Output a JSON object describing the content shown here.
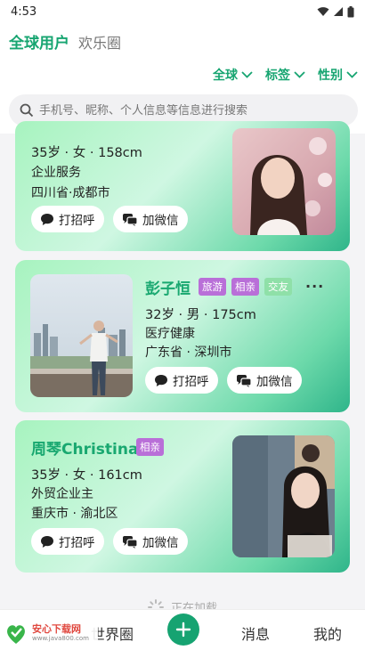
{
  "status": {
    "time": "4:53"
  },
  "header": {
    "tabs": [
      {
        "label": "全球用户",
        "active": true
      },
      {
        "label": "欢乐圈",
        "active": false
      }
    ],
    "filters": [
      {
        "label": "全球"
      },
      {
        "label": "标签"
      },
      {
        "label": "性别"
      }
    ],
    "search": {
      "placeholder": "手机号、昵称、个人信息等信息进行搜索"
    }
  },
  "cards": [
    {
      "name": "",
      "age_gender_height": "35岁 · 女 · 158cm",
      "industry": "企业服务",
      "location": "四川省·成都市",
      "greet_label": "打招呼",
      "wechat_label": "加微信"
    },
    {
      "name": "彭子恒",
      "tags": [
        "旅游",
        "相亲",
        "交友"
      ],
      "more": "···",
      "age_gender_height": "32岁 · 男 · 175cm",
      "industry": "医疗健康",
      "location": "广东省 · 深圳市",
      "greet_label": "打招呼",
      "wechat_label": "加微信"
    },
    {
      "name": "周琴Christina",
      "tags": [
        "相亲"
      ],
      "age_gender_height": "35岁 · 女 · 161cm",
      "industry": "外贸企业主",
      "location": "重庆市 · 渝北区",
      "greet_label": "打招呼",
      "wechat_label": "加微信"
    }
  ],
  "loading_text": "正在加载",
  "bottom_nav": {
    "world": "世界圈",
    "messages": "消息",
    "mine": "我的"
  },
  "watermark": {
    "title": "安心下载网",
    "url": "www.java800.com"
  },
  "colors": {
    "accent": "#17a571",
    "tag_purple": "#b96fd8",
    "tag_green": "#8fe0a8"
  }
}
